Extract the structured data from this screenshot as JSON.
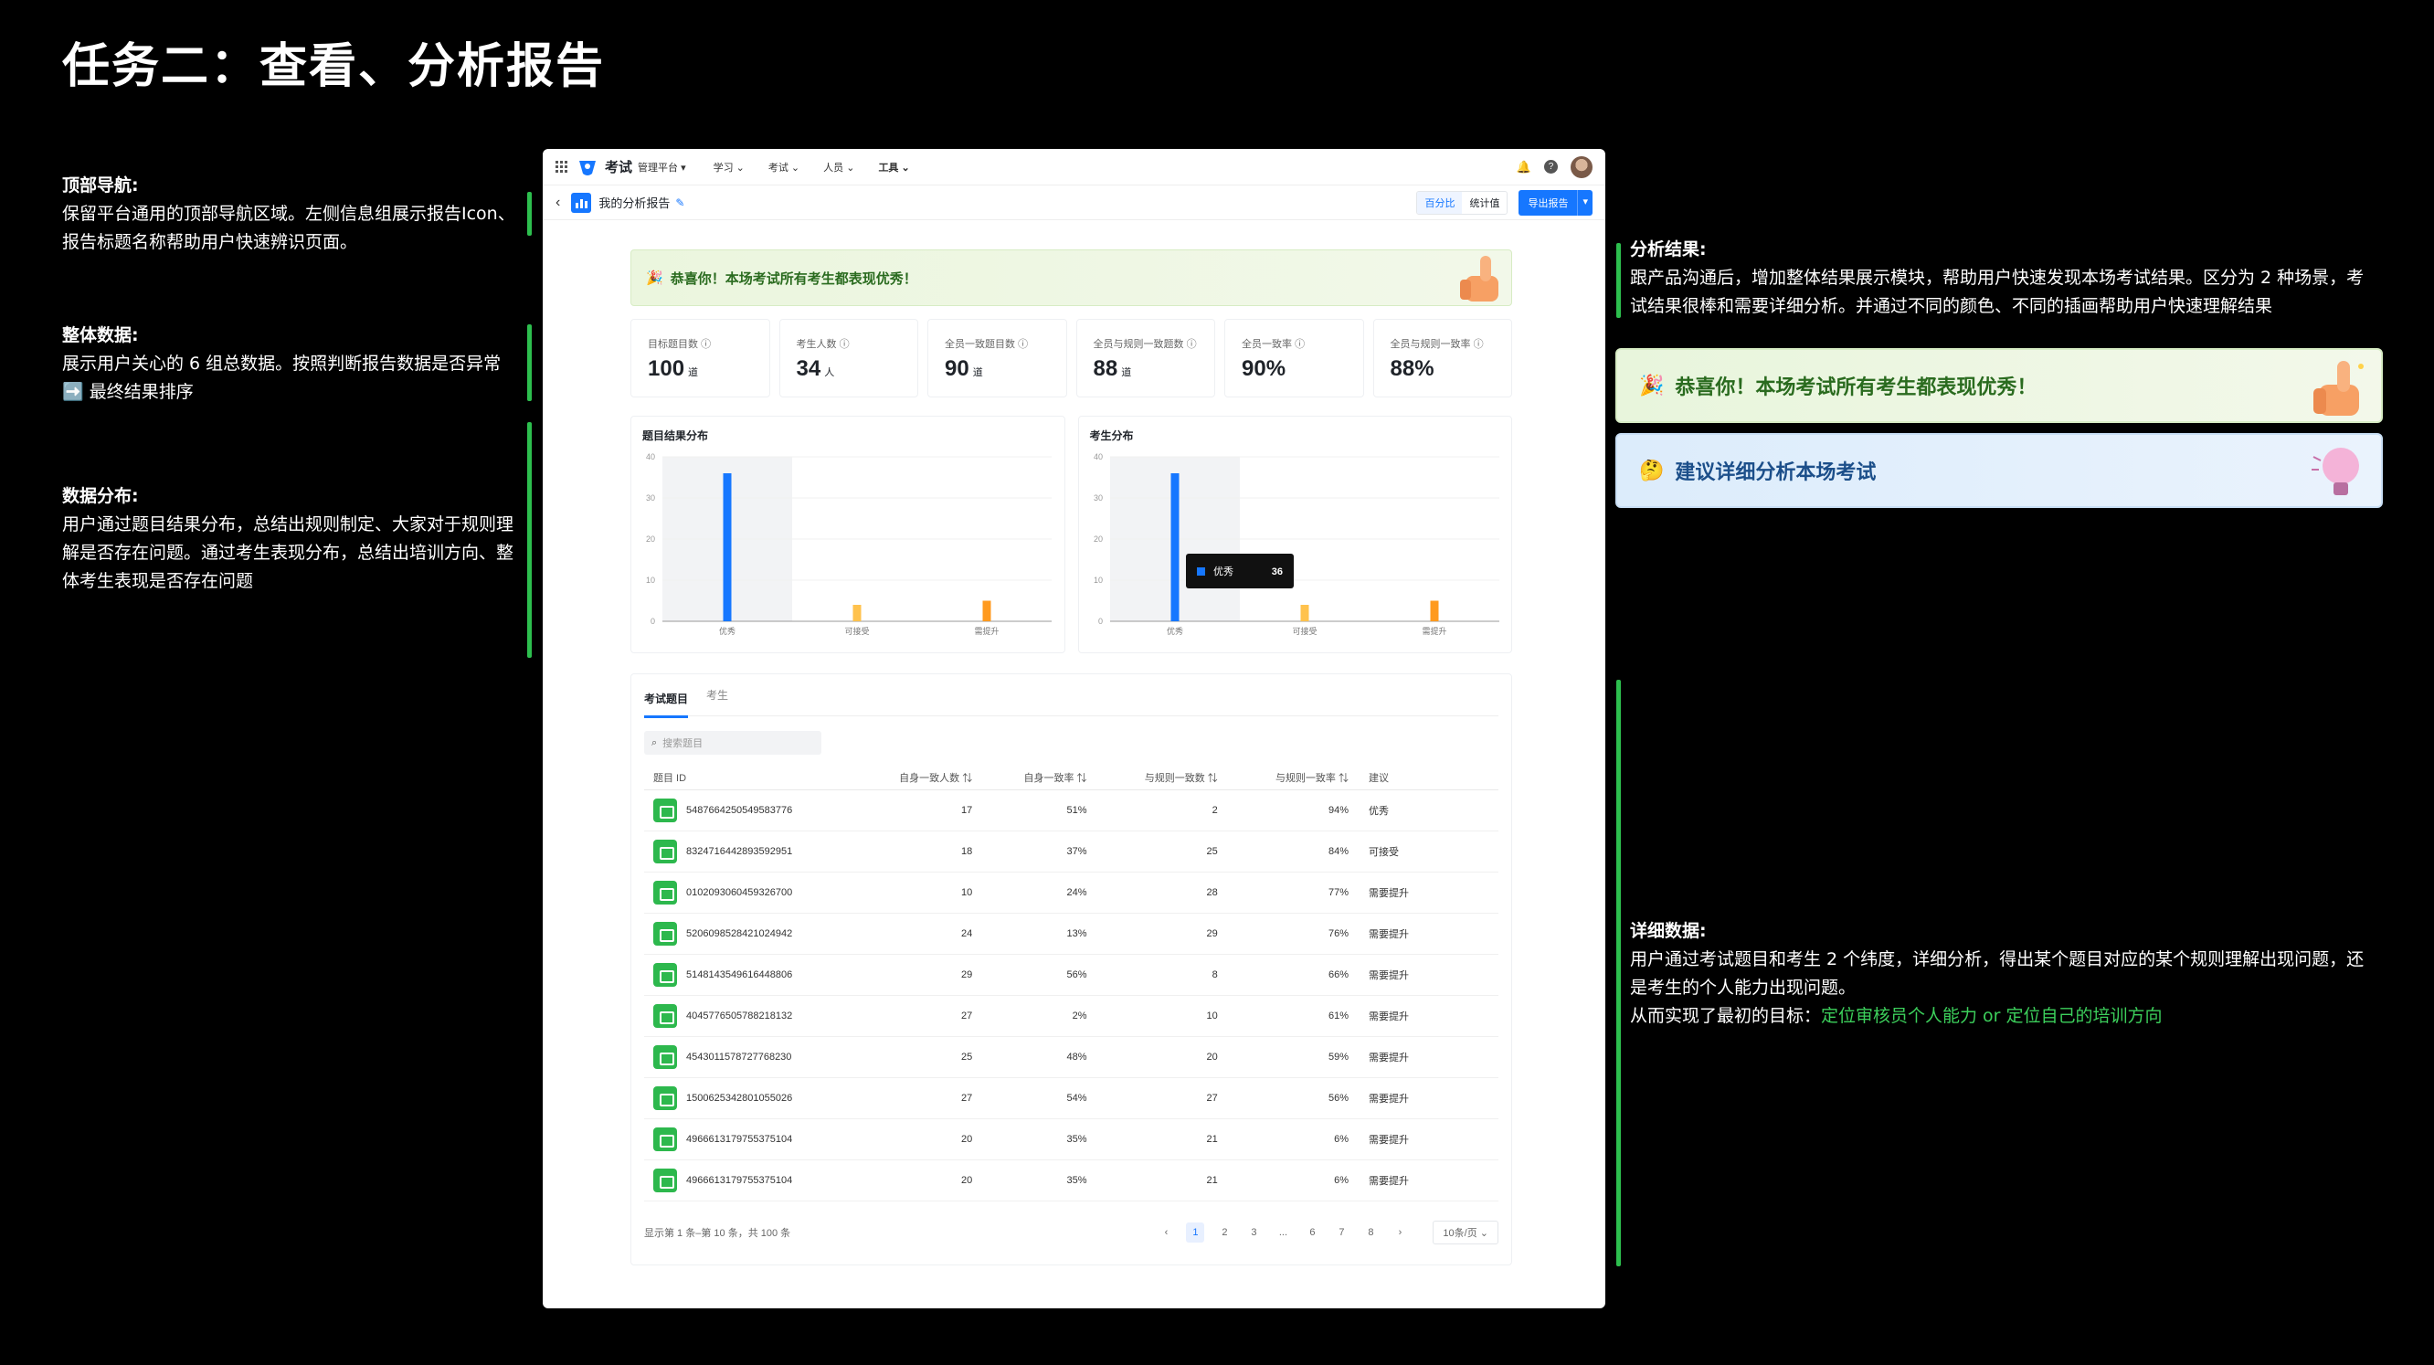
{
  "page_title": "任务二：查看、分析报告",
  "left_notes": [
    {
      "heading": "顶部导航:",
      "body": "保留平台通用的顶部导航区域。左侧信息组展示报告Icon、报告标题名称帮助用户快速辨识页面。"
    },
    {
      "heading": "整体数据:",
      "body": "展示用户关心的 6 组总数据。按照判断报告数据是否异常 ➡️ 最终结果排序"
    },
    {
      "heading": "数据分布:",
      "body": "用户通过题目结果分布，总结出规则制定、大家对于规则理解是否存在问题。通过考生表现分布，总结出培训方向、整体考生表现是否存在问题"
    }
  ],
  "right_notes": {
    "result_heading": "分析结果:",
    "result_body": "跟产品沟通后，增加整体结果展示模块，帮助用户快速发现本场考试结果。区分为 2 种场景，考试结果很棒和需要详细分析。并通过不同的颜色、不同的插画帮助用户快速理解结果",
    "banner_ok": "恭喜你！本场考试所有考生都表现优秀！",
    "banner_warn": "建议详细分析本场考试",
    "detail_heading": "详细数据:",
    "detail_body": "用户通过考试题目和考生 2 个纬度，详细分析，得出某个题目对应的某个规则理解出现问题，还是考生的个人能力出现问题。",
    "detail_goal_prefix": "从而实现了最初的目标：",
    "detail_goal": "定位审核员个人能力 or 定位自己的培训方向"
  },
  "app": {
    "brand": "考试",
    "platform": "管理平台",
    "menus": [
      "学习",
      "考试",
      "人员",
      "工具"
    ],
    "report_title": "我的分析报告",
    "seg": [
      "百分比",
      "统计值"
    ],
    "export": "导出报告",
    "banner": "恭喜你！本场考试所有考生都表现优秀！",
    "stats": [
      {
        "label": "目标题目数",
        "value": "100",
        "unit": "道"
      },
      {
        "label": "考生人数",
        "value": "34",
        "unit": "人"
      },
      {
        "label": "全员一致题目数",
        "value": "90",
        "unit": "道"
      },
      {
        "label": "全员与规则一致题数",
        "value": "88",
        "unit": "道"
      },
      {
        "label": "全员一致率",
        "value": "90%",
        "unit": ""
      },
      {
        "label": "全员与规则一致率",
        "value": "88%",
        "unit": ""
      }
    ],
    "tabs": [
      "考试题目",
      "考生"
    ],
    "search_placeholder": "搜索题目",
    "columns": [
      "题目 ID",
      "自身一致人数",
      "自身一致率",
      "与规则一致数",
      "与规则一致率",
      "建议"
    ],
    "rows": [
      [
        "5487664250549583776",
        "17",
        "51%",
        "2",
        "94%",
        "优秀"
      ],
      [
        "8324716442893592951",
        "18",
        "37%",
        "25",
        "84%",
        "可接受"
      ],
      [
        "0102093060459326700",
        "10",
        "24%",
        "28",
        "77%",
        "需要提升"
      ],
      [
        "5206098528421024942",
        "24",
        "13%",
        "29",
        "76%",
        "需要提升"
      ],
      [
        "5148143549616448806",
        "29",
        "56%",
        "8",
        "66%",
        "需要提升"
      ],
      [
        "4045776505788218132",
        "27",
        "2%",
        "10",
        "61%",
        "需要提升"
      ],
      [
        "4543011578727768230",
        "25",
        "48%",
        "20",
        "59%",
        "需要提升"
      ],
      [
        "1500625342801055026",
        "27",
        "54%",
        "27",
        "56%",
        "需要提升"
      ],
      [
        "4966613179755375104",
        "20",
        "35%",
        "21",
        "6%",
        "需要提升"
      ],
      [
        "4966613179755375104",
        "20",
        "35%",
        "21",
        "6%",
        "需要提升"
      ]
    ],
    "pager_info": "显示第 1 条–第 10 条，共 100 条",
    "pages": [
      "1",
      "2",
      "3",
      "...",
      "6",
      "7",
      "8"
    ],
    "page_size": "10条/页",
    "tooltip": {
      "name": "优秀",
      "value": "36"
    }
  },
  "chart_data": [
    {
      "type": "bar",
      "title": "题目结果分布",
      "categories": [
        "优秀",
        "可接受",
        "需提升"
      ],
      "values": [
        36,
        4,
        5
      ],
      "ylim": [
        0,
        40
      ],
      "yticks": [
        0,
        10,
        20,
        30,
        40
      ],
      "colors": [
        "#1677ff",
        "#ffc24d",
        "#ff9a1f"
      ]
    },
    {
      "type": "bar",
      "title": "考生分布",
      "categories": [
        "优秀",
        "可接受",
        "需提升"
      ],
      "values": [
        36,
        4,
        5
      ],
      "ylim": [
        0,
        40
      ],
      "yticks": [
        0,
        10,
        20,
        30,
        40
      ],
      "colors": [
        "#1677ff",
        "#ffc24d",
        "#ff9a1f"
      ]
    }
  ]
}
